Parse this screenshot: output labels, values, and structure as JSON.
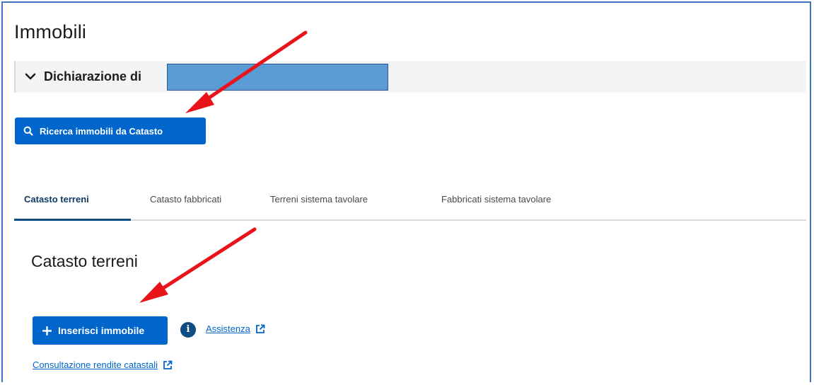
{
  "page": {
    "title": "Immobili"
  },
  "accordion": {
    "label": "Dichiarazione di",
    "expanded": true
  },
  "search_button": {
    "label": "Ricerca immobili da Catasto",
    "icon": "search-icon"
  },
  "tabs": [
    {
      "label": "Catasto terreni",
      "active": true
    },
    {
      "label": "Catasto fabbricati",
      "active": false
    },
    {
      "label": "Terreni sistema tavolare",
      "active": false
    },
    {
      "label": "Fabbricati sistema tavolare",
      "active": false
    }
  ],
  "section": {
    "title": "Catasto terreni"
  },
  "add_button": {
    "label": "Inserisci immobile",
    "icon": "plus-icon"
  },
  "links": {
    "assistance": "Assistenza",
    "rendite": "Consultazione rendite catastali"
  },
  "colors": {
    "primary": "#0066cc",
    "tab_active": "#0f4c81",
    "annotation_arrow": "#e8141a",
    "redaction": "#5b9bd5"
  }
}
